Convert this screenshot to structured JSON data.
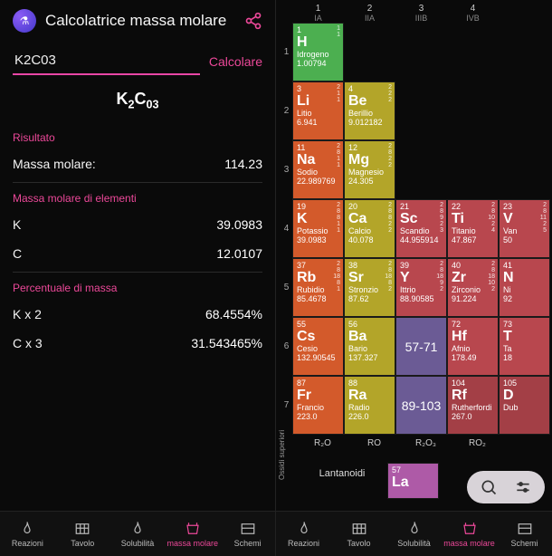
{
  "app": {
    "title": "Calcolatrice massa molare"
  },
  "input": {
    "value": "K2C03",
    "calc_label": "Calcolare"
  },
  "formula_display": "K₂C₀₃",
  "sections": {
    "risultato": "Risultato",
    "massa_molare_label": "Massa molare:",
    "massa_molare_value": "114.23",
    "elementi": "Massa molare di elementi",
    "percentuale": "Percentuale di massa"
  },
  "element_rows": [
    {
      "name": "K",
      "value": "39.0983"
    },
    {
      "name": "C",
      "value": "12.0107"
    }
  ],
  "percent_rows": [
    {
      "name": "K x 2",
      "value": "68.4554%"
    },
    {
      "name": "C x 3",
      "value": "31.543465%"
    }
  ],
  "nav": [
    {
      "key": "reazioni",
      "label": "Reazioni"
    },
    {
      "key": "tavolo",
      "label": "Tavolo"
    },
    {
      "key": "solubilita",
      "label": "Solubilità"
    },
    {
      "key": "massa-molare",
      "label": "massa molare"
    },
    {
      "key": "schemi",
      "label": "Schemi"
    }
  ],
  "pt_cols": [
    {
      "n": "1",
      "g": "IA"
    },
    {
      "n": "2",
      "g": "IIA"
    },
    {
      "n": "3",
      "g": "IIIB"
    },
    {
      "n": "4",
      "g": "IVB"
    }
  ],
  "pt": {
    "r1": [
      {
        "num": "1",
        "sym": "H",
        "name": "Idrogeno",
        "mass": "1.00794",
        "cls": "c-h",
        "ox": "1\n1"
      }
    ],
    "r2": [
      {
        "num": "3",
        "sym": "Li",
        "name": "Litio",
        "mass": "6.941",
        "cls": "c-alk",
        "ox": "2\n1\n1"
      },
      {
        "num": "4",
        "sym": "Be",
        "name": "Berillio",
        "mass": "9.012182",
        "cls": "c-aearth",
        "ox": "2\n2\n2"
      }
    ],
    "r3": [
      {
        "num": "11",
        "sym": "Na",
        "name": "Sodio",
        "mass": "22.989769",
        "cls": "c-alk",
        "ox": "2\n8\n1\n1"
      },
      {
        "num": "12",
        "sym": "Mg",
        "name": "Magnesio",
        "mass": "24.305",
        "cls": "c-aearth",
        "ox": "2\n8\n2\n2"
      }
    ],
    "r4": [
      {
        "num": "19",
        "sym": "K",
        "name": "Potassio",
        "mass": "39.0983",
        "cls": "c-alk",
        "ox": "2\n8\n8\n1\n1"
      },
      {
        "num": "20",
        "sym": "Ca",
        "name": "Calcio",
        "mass": "40.078",
        "cls": "c-aearth",
        "ox": "2\n8\n8\n2\n2"
      },
      {
        "num": "21",
        "sym": "Sc",
        "name": "Scandio",
        "mass": "44.955914",
        "cls": "c-tm",
        "ox": "2\n8\n9\n2\n3"
      },
      {
        "num": "22",
        "sym": "Ti",
        "name": "Titanio",
        "mass": "47.867",
        "cls": "c-tm",
        "ox": "2\n8\n10\n2\n4"
      },
      {
        "num": "23",
        "sym": "V",
        "name": "Van",
        "mass": "50",
        "cls": "c-tm",
        "ox": "2\n8\n11\n2\n5"
      }
    ],
    "r5": [
      {
        "num": "37",
        "sym": "Rb",
        "name": "Rubidio",
        "mass": "85.4678",
        "cls": "c-alk",
        "ox": "2\n8\n18\n8\n1"
      },
      {
        "num": "38",
        "sym": "Sr",
        "name": "Stronzio",
        "mass": "87.62",
        "cls": "c-aearth",
        "ox": "2\n8\n18\n8\n2"
      },
      {
        "num": "39",
        "sym": "Y",
        "name": "Ittrio",
        "mass": "88.90585",
        "cls": "c-tm",
        "ox": "2\n8\n18\n9\n2"
      },
      {
        "num": "40",
        "sym": "Zr",
        "name": "Zirconio",
        "mass": "91.224",
        "cls": "c-tm",
        "ox": "2\n8\n18\n10\n2"
      },
      {
        "num": "41",
        "sym": "N",
        "name": "Ni",
        "mass": "92",
        "cls": "c-tm",
        "ox": ""
      }
    ],
    "r6": [
      {
        "num": "55",
        "sym": "Cs",
        "name": "Cesio",
        "mass": "132.90545",
        "cls": "c-alk",
        "ox": ""
      },
      {
        "num": "56",
        "sym": "Ba",
        "name": "Bario",
        "mass": "137.327",
        "cls": "c-aearth",
        "ox": ""
      },
      {
        "range": "57-71"
      },
      {
        "num": "72",
        "sym": "Hf",
        "name": "Afnio",
        "mass": "178.49",
        "cls": "c-tm",
        "ox": ""
      },
      {
        "num": "73",
        "sym": "T",
        "name": "Ta",
        "mass": "18",
        "cls": "c-tm",
        "ox": ""
      }
    ],
    "r7": [
      {
        "num": "87",
        "sym": "Fr",
        "name": "Francio",
        "mass": "223.0",
        "cls": "c-alk",
        "ox": ""
      },
      {
        "num": "88",
        "sym": "Ra",
        "name": "Radio",
        "mass": "226.0",
        "cls": "c-aearth",
        "ox": ""
      },
      {
        "range": "89-103"
      },
      {
        "num": "104",
        "sym": "Rf",
        "name": "Rutherfordi",
        "mass": "267.0",
        "cls": "c-tm2",
        "ox": ""
      },
      {
        "num": "105",
        "sym": "D",
        "name": "Dub",
        "mass": "",
        "cls": "c-tm2",
        "ox": ""
      }
    ]
  },
  "oxides": [
    "R₂O",
    "RO",
    "R₂O₃",
    "RO₂"
  ],
  "oxide_label": "Ossidi\nsuperiori",
  "lan_label": "Lantanoidi",
  "lan_first": {
    "num": "57",
    "sym": "La",
    "name": "",
    "mass": "",
    "cls": "c-lan"
  }
}
